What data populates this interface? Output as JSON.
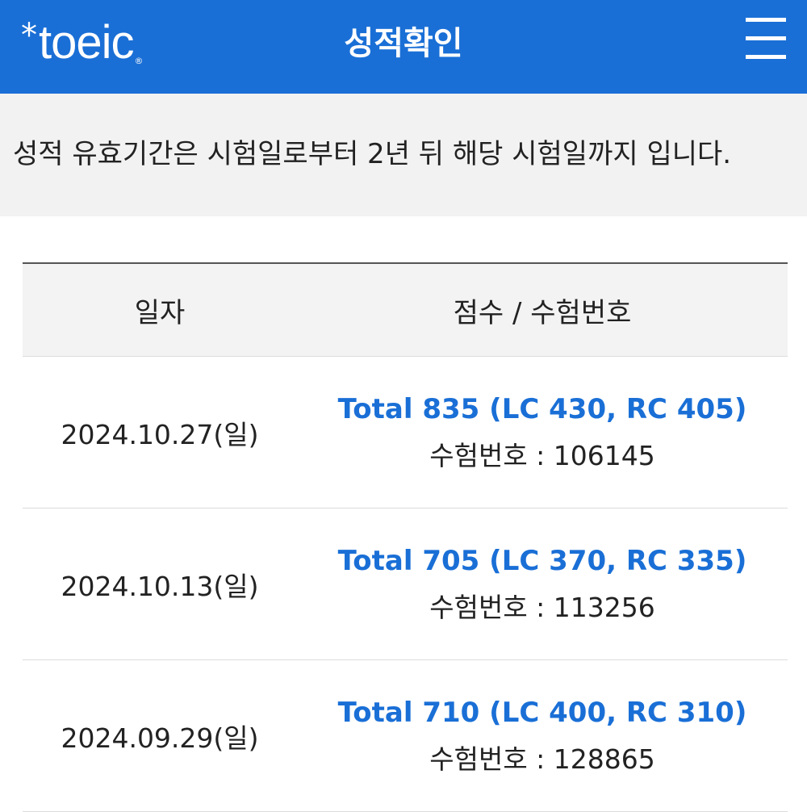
{
  "header": {
    "logo_text": "toeic",
    "logo_star": "*",
    "logo_mark": "®",
    "title": "성적확인",
    "menu_icon": "hamburger-menu-icon"
  },
  "notice": {
    "text": "성적 유효기간은 시험일로부터 2년 뒤 해당 시험일까지 입니다."
  },
  "table": {
    "headers": {
      "date": "일자",
      "score": "점수 / 수험번호"
    },
    "rows": [
      {
        "date": "2024.10.27(일)",
        "score": "Total 835 (LC 430, RC 405)",
        "exam_number": "수험번호 : 106145"
      },
      {
        "date": "2024.10.13(일)",
        "score": "Total 705 (LC 370, RC 335)",
        "exam_number": "수험번호 : 113256"
      },
      {
        "date": "2024.09.29(일)",
        "score": "Total 710 (LC 400, RC 310)",
        "exam_number": "수험번호 : 128865"
      }
    ]
  },
  "colors": {
    "brand_blue": "#1a6fd6",
    "notice_bg": "#f2f2f2",
    "header_row_bg": "#f3f3f3"
  }
}
